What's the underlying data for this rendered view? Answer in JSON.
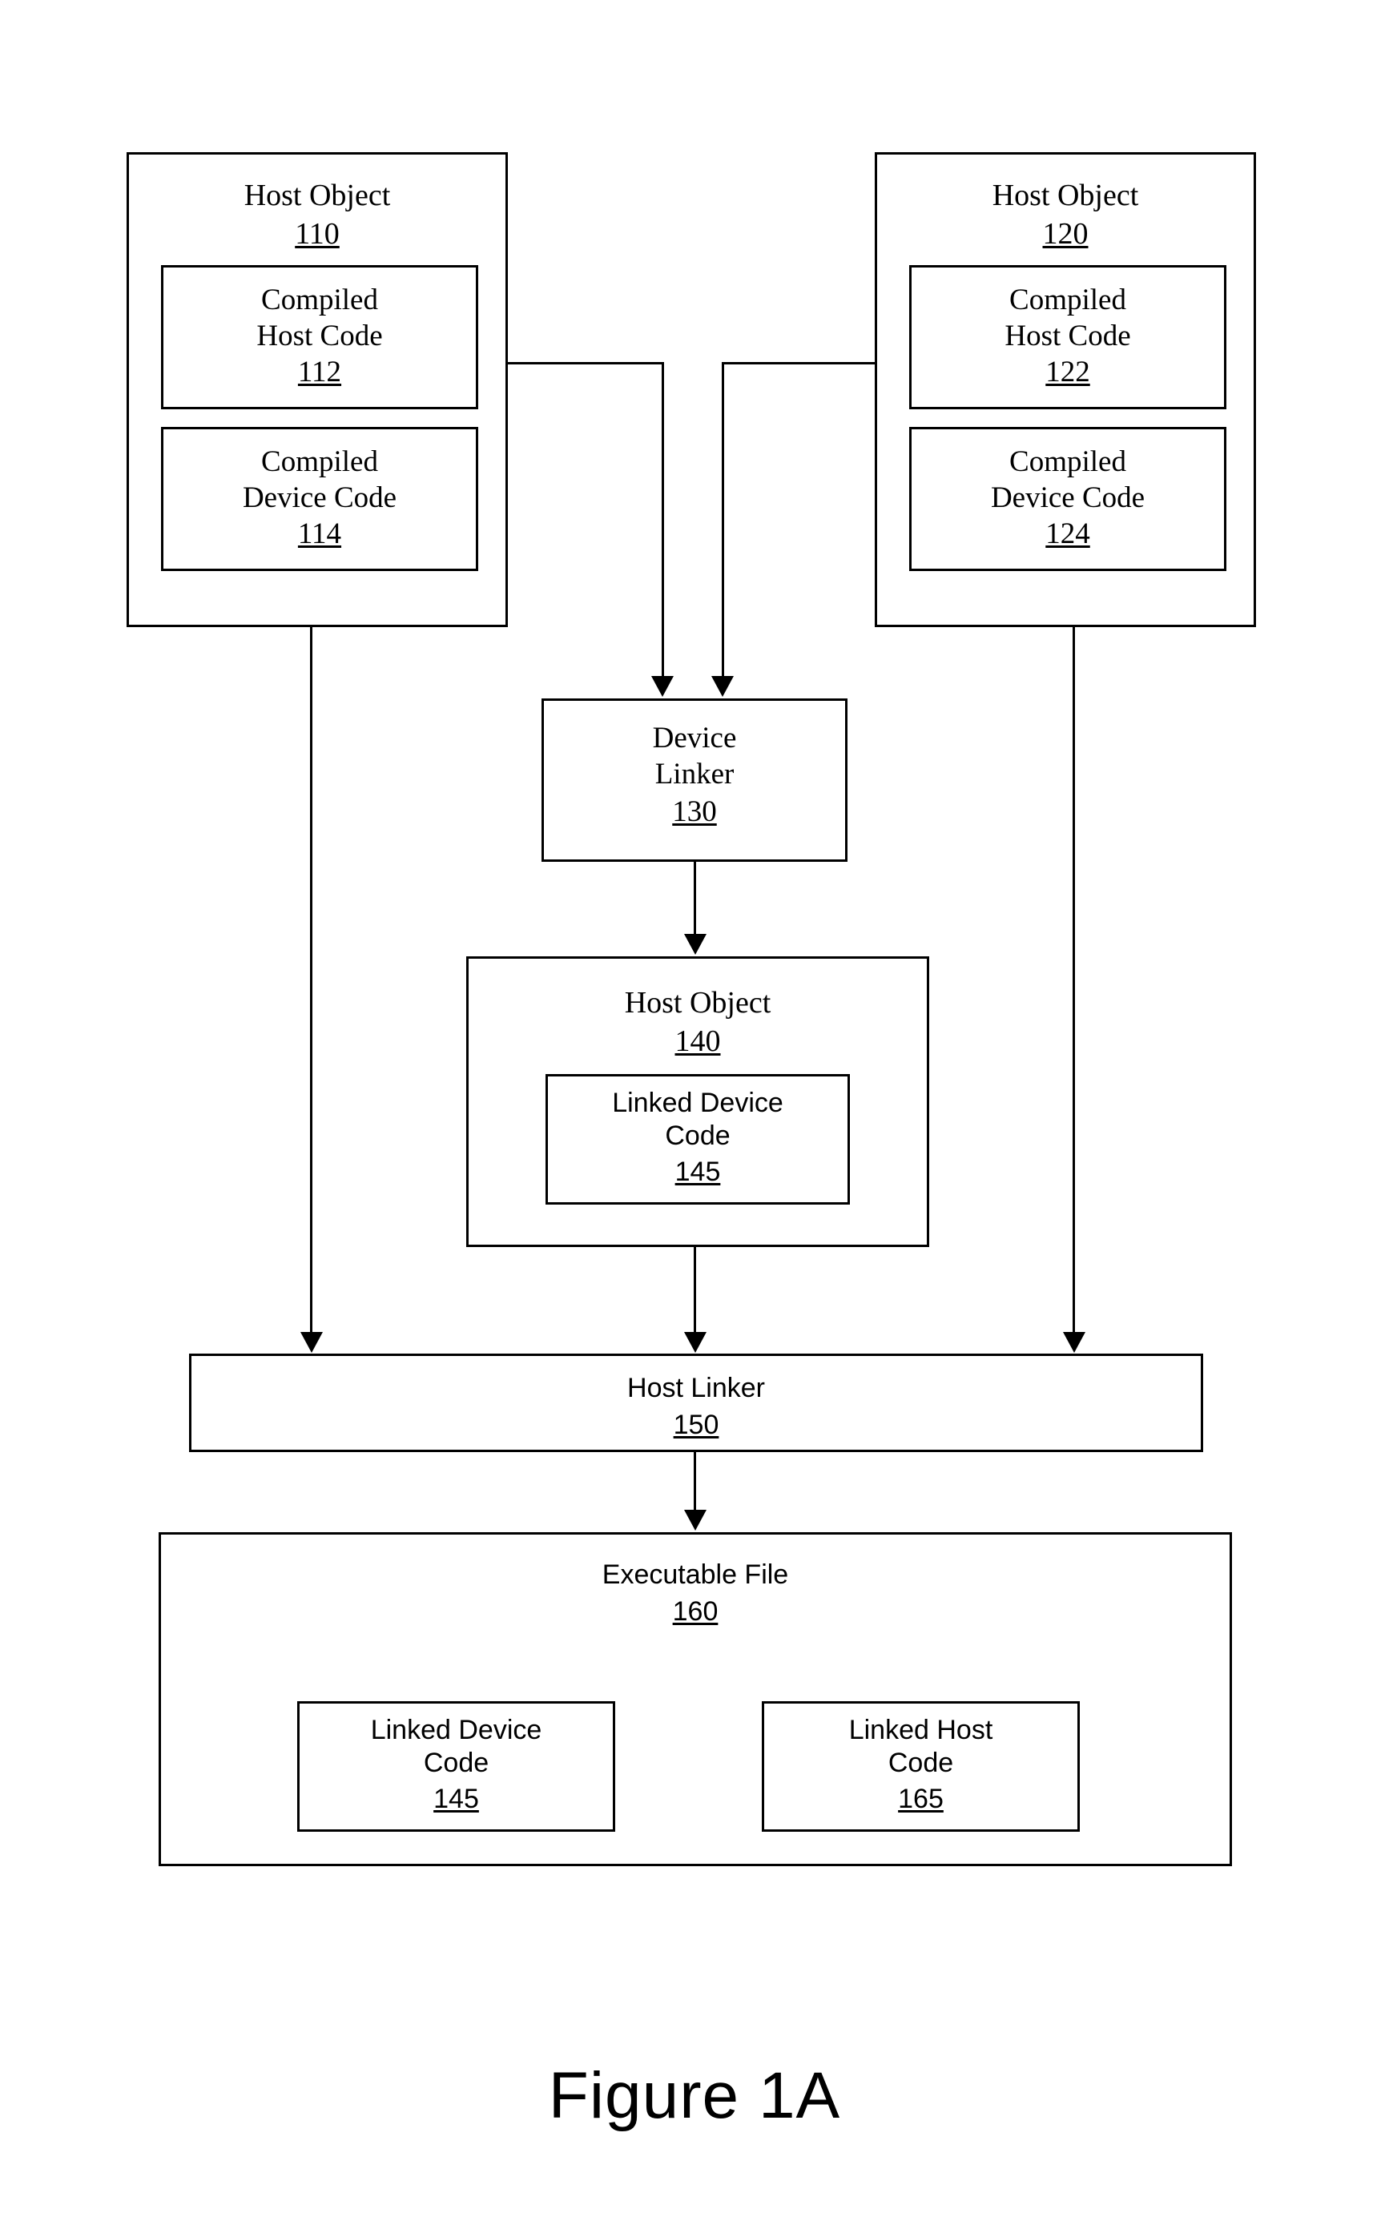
{
  "figure": {
    "caption": "Figure 1A",
    "type": "patent-flow-diagram"
  },
  "nodes": {
    "host_object_110": {
      "title": "Host Object",
      "ref": "110",
      "children": {
        "compiled_host_code_112": {
          "title": "Compiled\nHost Code",
          "ref": "112"
        },
        "compiled_device_code_114": {
          "title": "Compiled\nDevice Code",
          "ref": "114"
        }
      }
    },
    "host_object_120": {
      "title": "Host Object",
      "ref": "120",
      "children": {
        "compiled_host_code_122": {
          "title": "Compiled\nHost Code",
          "ref": "122"
        },
        "compiled_device_code_124": {
          "title": "Compiled\nDevice Code",
          "ref": "124"
        }
      }
    },
    "device_linker_130": {
      "title": "Device\nLinker",
      "ref": "130"
    },
    "host_object_140": {
      "title": "Host Object",
      "ref": "140",
      "children": {
        "linked_device_code_145": {
          "title": "Linked Device\nCode",
          "ref": "145"
        }
      }
    },
    "host_linker_150": {
      "title": "Host Linker",
      "ref": "150"
    },
    "executable_file_160": {
      "title": "Executable File",
      "ref": "160",
      "children": {
        "linked_device_code_145": {
          "title": "Linked Device\nCode",
          "ref": "145"
        },
        "linked_host_code_165": {
          "title": "Linked Host\nCode",
          "ref": "165"
        }
      }
    }
  },
  "colors": {
    "line": "#000000",
    "background": "#ffffff"
  }
}
